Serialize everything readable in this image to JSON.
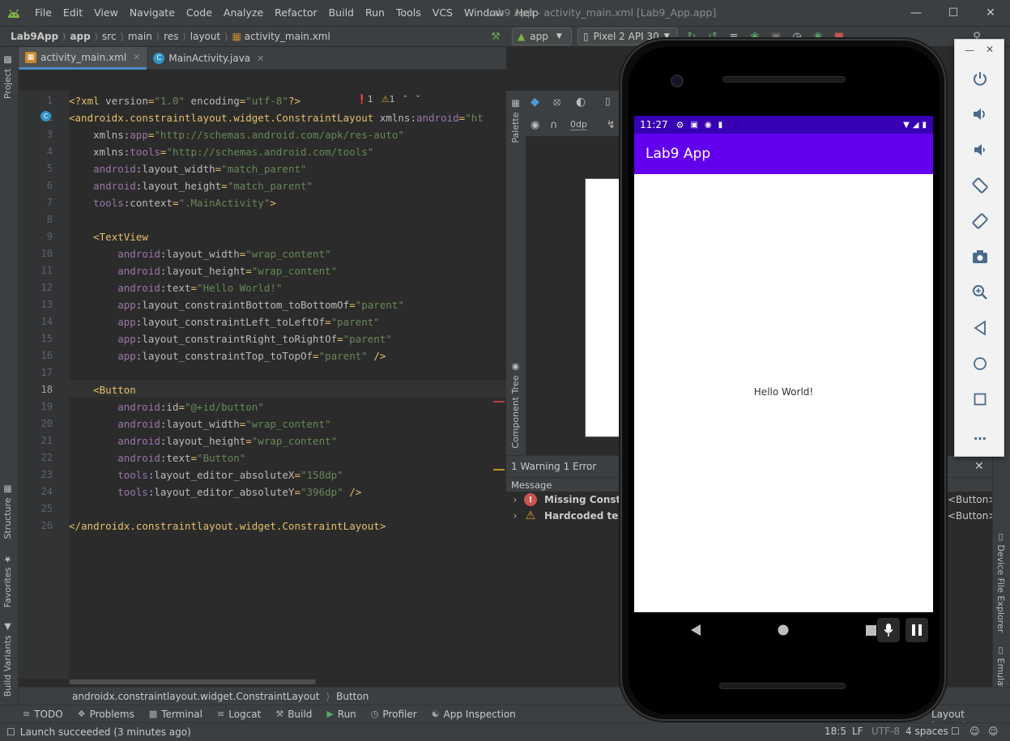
{
  "menu": [
    "File",
    "Edit",
    "View",
    "Navigate",
    "Code",
    "Analyze",
    "Refactor",
    "Build",
    "Run",
    "Tools",
    "VCS",
    "Window",
    "Help"
  ],
  "window_title": "Lab9 App - activity_main.xml [Lab9_App.app]",
  "breadcrumbs": [
    "Lab9App",
    "app",
    "src",
    "main",
    "res",
    "layout",
    "activity_main.xml"
  ],
  "run_config": "app",
  "device": "Pixel 2 API 30",
  "left_tabs": {
    "project": "Project",
    "structure": "Structure",
    "favorites": "Favorites",
    "build_variants": "Build Variants"
  },
  "editor_tabs": [
    {
      "label": "activity_main.xml",
      "active": true
    },
    {
      "label": "MainActivity.java",
      "active": false
    }
  ],
  "inspection": {
    "errors": "1",
    "warnings": "1"
  },
  "code_lines": [
    [
      [
        "c-pun",
        "<?"
      ],
      [
        "c-tag",
        "xml "
      ],
      [
        "c-attr",
        "version"
      ],
      [
        "c-pun",
        "="
      ],
      [
        "c-val",
        "\"1.0\""
      ],
      [
        "c-attr",
        " encoding"
      ],
      [
        "c-pun",
        "="
      ],
      [
        "c-val",
        "\"utf-8\""
      ],
      [
        "c-pun",
        "?>"
      ]
    ],
    [
      [
        "c-pun",
        "<"
      ],
      [
        "c-tag",
        "androidx.constraintlayout.widget.ConstraintLayout"
      ],
      [
        "c-attr",
        " xmlns:"
      ],
      [
        "c-ns",
        "android"
      ],
      [
        "c-pun",
        "="
      ],
      [
        "c-val",
        "\"ht"
      ]
    ],
    [
      [
        "c-attr",
        "    xmlns:"
      ],
      [
        "c-ns",
        "app"
      ],
      [
        "c-pun",
        "="
      ],
      [
        "c-val",
        "\"http://schemas.android.com/apk/res-auto\""
      ]
    ],
    [
      [
        "c-attr",
        "    xmlns:"
      ],
      [
        "c-ns",
        "tools"
      ],
      [
        "c-pun",
        "="
      ],
      [
        "c-val",
        "\"http://schemas.android.com/tools\""
      ]
    ],
    [
      [
        "c-ns",
        "    android"
      ],
      [
        "c-attr",
        ":layout_width"
      ],
      [
        "c-pun",
        "="
      ],
      [
        "c-val",
        "\"match_parent\""
      ]
    ],
    [
      [
        "c-ns",
        "    android"
      ],
      [
        "c-attr",
        ":layout_height"
      ],
      [
        "c-pun",
        "="
      ],
      [
        "c-val",
        "\"match_parent\""
      ]
    ],
    [
      [
        "c-ns",
        "    tools"
      ],
      [
        "c-attr",
        ":context"
      ],
      [
        "c-pun",
        "="
      ],
      [
        "c-val",
        "\".MainActivity\""
      ],
      [
        "c-pun",
        ">"
      ]
    ],
    [
      [
        "c-attr",
        ""
      ]
    ],
    [
      [
        "c-pun",
        "    <"
      ],
      [
        "c-tag",
        "TextView"
      ]
    ],
    [
      [
        "c-ns",
        "        android"
      ],
      [
        "c-attr",
        ":layout_width"
      ],
      [
        "c-pun",
        "="
      ],
      [
        "c-val",
        "\"wrap_content\""
      ]
    ],
    [
      [
        "c-ns",
        "        android"
      ],
      [
        "c-attr",
        ":layout_height"
      ],
      [
        "c-pun",
        "="
      ],
      [
        "c-val",
        "\"wrap_content\""
      ]
    ],
    [
      [
        "c-ns",
        "        android"
      ],
      [
        "c-attr",
        ":text"
      ],
      [
        "c-pun",
        "="
      ],
      [
        "c-val",
        "\"Hello World!\""
      ]
    ],
    [
      [
        "c-ns",
        "        app"
      ],
      [
        "c-attr",
        ":layout_constraintBottom_toBottomOf"
      ],
      [
        "c-pun",
        "="
      ],
      [
        "c-val",
        "\"parent\""
      ]
    ],
    [
      [
        "c-ns",
        "        app"
      ],
      [
        "c-attr",
        ":layout_constraintLeft_toLeftOf"
      ],
      [
        "c-pun",
        "="
      ],
      [
        "c-val",
        "\"parent\""
      ]
    ],
    [
      [
        "c-ns",
        "        app"
      ],
      [
        "c-attr",
        ":layout_constraintRight_toRightOf"
      ],
      [
        "c-pun",
        "="
      ],
      [
        "c-val",
        "\"parent\""
      ]
    ],
    [
      [
        "c-ns",
        "        app"
      ],
      [
        "c-attr",
        ":layout_constraintTop_toTopOf"
      ],
      [
        "c-pun",
        "="
      ],
      [
        "c-val",
        "\"parent\""
      ],
      [
        "c-pun",
        " />"
      ]
    ],
    [
      [
        "c-attr",
        ""
      ]
    ],
    [
      [
        "c-pun",
        "    <"
      ],
      [
        "c-tag",
        "Button"
      ]
    ],
    [
      [
        "c-ns",
        "        android"
      ],
      [
        "c-attr",
        ":id"
      ],
      [
        "c-pun",
        "="
      ],
      [
        "c-val",
        "\"@+id/button\""
      ]
    ],
    [
      [
        "c-ns",
        "        android"
      ],
      [
        "c-attr",
        ":layout_width"
      ],
      [
        "c-pun",
        "="
      ],
      [
        "c-val",
        "\"wrap_content\""
      ]
    ],
    [
      [
        "c-ns",
        "        android"
      ],
      [
        "c-attr",
        ":layout_height"
      ],
      [
        "c-pun",
        "="
      ],
      [
        "c-val",
        "\"wrap_content\""
      ]
    ],
    [
      [
        "c-ns",
        "        android"
      ],
      [
        "c-attr",
        ":text"
      ],
      [
        "c-pun",
        "="
      ],
      [
        "c-val",
        "\"Button\""
      ]
    ],
    [
      [
        "c-ns",
        "        tools"
      ],
      [
        "c-attr",
        ":layout_editor_absoluteX"
      ],
      [
        "c-pun",
        "="
      ],
      [
        "c-val",
        "\"158dp\""
      ]
    ],
    [
      [
        "c-ns",
        "        tools"
      ],
      [
        "c-attr",
        ":layout_editor_absoluteY"
      ],
      [
        "c-pun",
        "="
      ],
      [
        "c-val",
        "\"396dp\""
      ],
      [
        "c-pun",
        " />"
      ]
    ],
    [
      [
        "c-attr",
        ""
      ]
    ],
    [
      [
        "c-pun",
        "</"
      ],
      [
        "c-tag",
        "androidx.constraintlayout.widget.ConstraintLayout"
      ],
      [
        "c-pun",
        ">"
      ]
    ]
  ],
  "current_line": 18,
  "design": {
    "palette": "Palette",
    "component_tree": "Component Tree",
    "margin": "0dp"
  },
  "problems": {
    "header": "1 Warning 1 Error",
    "column": "Message",
    "items": [
      {
        "severity": "error",
        "text": "Missing Constrai",
        "ref": "<Button>"
      },
      {
        "severity": "warning",
        "text": "Hardcoded text",
        "ref": "<Button>"
      }
    ]
  },
  "bottom_crumbs": [
    "androidx.constraintlayout.widget.ConstraintLayout",
    "Button"
  ],
  "tool_windows": [
    "TODO",
    "Problems",
    "Terminal",
    "Logcat",
    "Build",
    "Run",
    "Profiler",
    "App Inspection"
  ],
  "right_tabs": {
    "device_file_explorer": "Device File Explorer",
    "emulator": "Emulator",
    "layout_inspector": "Layout Inspector"
  },
  "status": {
    "message": "Launch succeeded (3 minutes ago)",
    "position": "18:5",
    "line_sep": "LF",
    "encoding": "UTF-8",
    "indent": "4 spaces"
  },
  "emulator": {
    "clock": "11:27",
    "app_title": "Lab9 App",
    "content_text": "Hello World!",
    "status_bar_color": "#3700b3",
    "app_bar_color": "#6200ee",
    "controls": [
      "power-icon",
      "volume-up-icon",
      "volume-down-icon",
      "rotate-left-icon",
      "rotate-right-icon",
      "camera-icon",
      "zoom-icon",
      "back-icon",
      "home-icon",
      "overview-icon",
      "more-icon"
    ]
  }
}
